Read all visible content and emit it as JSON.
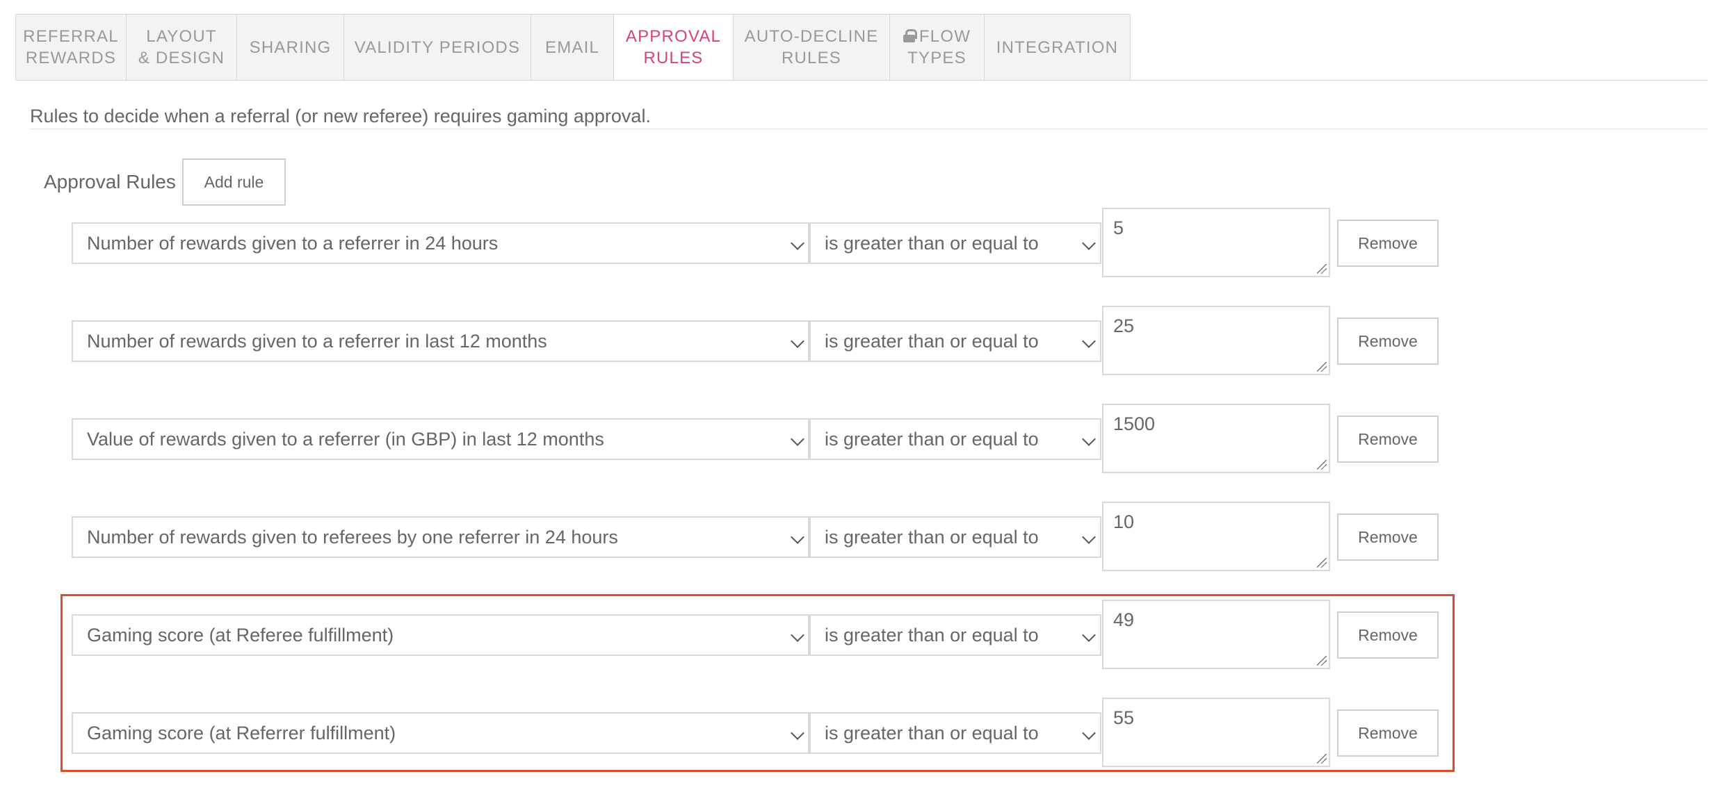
{
  "tabs": [
    {
      "label": "REFERRAL\nREWARDS",
      "active": false
    },
    {
      "label": "LAYOUT\n& DESIGN",
      "active": false
    },
    {
      "label": "SHARING",
      "active": false
    },
    {
      "label": "VALIDITY PERIODS",
      "active": false
    },
    {
      "label": "EMAIL",
      "active": false
    },
    {
      "label": "APPROVAL\nRULES",
      "active": true
    },
    {
      "label": "AUTO-DECLINE\nRULES",
      "active": false
    },
    {
      "label": "FLOW\nTYPES",
      "active": false,
      "icon": "lock-icon"
    },
    {
      "label": "INTEGRATION",
      "active": false
    }
  ],
  "description": "Rules to decide when a referral (or new referee) requires gaming approval.",
  "approval_rules": {
    "label": "Approval Rules",
    "add_label": "Add rule",
    "remove_label": "Remove",
    "rules": [
      {
        "metric": "Number of rewards given to a referrer in 24 hours",
        "operator": "is greater than or equal to",
        "value": "5"
      },
      {
        "metric": "Number of rewards given to a referrer in last 12 months",
        "operator": "is greater than or equal to",
        "value": "25"
      },
      {
        "metric": "Value of rewards given to a referrer (in GBP) in last 12 months",
        "operator": "is greater than or equal to",
        "value": "1500"
      },
      {
        "metric": "Number of rewards given to referees by one referrer in 24 hours",
        "operator": "is greater than or equal to",
        "value": "10"
      },
      {
        "metric": "Gaming score (at Referee fulfillment)",
        "operator": "is greater than or equal to",
        "value": "49"
      },
      {
        "metric": "Gaming score (at Referrer fulfillment)",
        "operator": "is greater than or equal to",
        "value": "55"
      }
    ]
  },
  "colors": {
    "accent": "#d6417e",
    "highlight": "#e04a2e"
  }
}
